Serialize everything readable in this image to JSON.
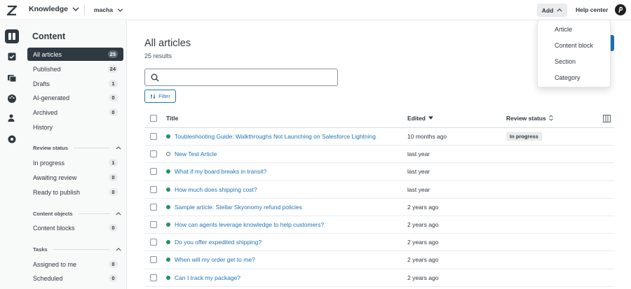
{
  "topbar": {
    "product": "Knowledge",
    "brand": "macha",
    "add_label": "Add",
    "help_label": "Help center"
  },
  "sidebar": {
    "title": "Content",
    "items": [
      {
        "label": "All articles",
        "count": "25"
      },
      {
        "label": "Published",
        "count": "24"
      },
      {
        "label": "Drafts",
        "count": "1"
      },
      {
        "label": "AI-generated",
        "count": "0"
      },
      {
        "label": "Archived",
        "count": "0"
      },
      {
        "label": "History"
      }
    ],
    "review_section": "Review status",
    "review_items": [
      {
        "label": "In progress",
        "count": "1"
      },
      {
        "label": "Awaiting review",
        "count": "0"
      },
      {
        "label": "Ready to publish",
        "count": "0"
      }
    ],
    "objects_section": "Content objects",
    "objects_items": [
      {
        "label": "Content blocks",
        "count": "0"
      }
    ],
    "tasks_section": "Tasks",
    "tasks_items": [
      {
        "label": "Assigned to me",
        "count": "0"
      },
      {
        "label": "Scheduled",
        "count": "0"
      }
    ]
  },
  "main": {
    "title": "All articles",
    "results": "25 results",
    "filter_label": "Filter",
    "columns": {
      "title": "Title",
      "edited": "Edited",
      "review": "Review status"
    },
    "rows": [
      {
        "title": "Toubleshooting Guide: Walkthroughs Not Launching on Salesforce Lightning",
        "edited": "10 months ago",
        "review": "In progress",
        "status": "published"
      },
      {
        "title": "New Test Article",
        "edited": "last year",
        "review": "",
        "status": "draft"
      },
      {
        "title": "What if my board breaks in transit?",
        "edited": "last year",
        "review": "",
        "status": "published"
      },
      {
        "title": "How much does shipping cost?",
        "edited": "last year",
        "review": "",
        "status": "published"
      },
      {
        "title": "Sample article: Stellar Skyonomy refund policies",
        "edited": "2 years ago",
        "review": "",
        "status": "published"
      },
      {
        "title": "How can agents leverage knowledge to help customers?",
        "edited": "2 years ago",
        "review": "",
        "status": "published"
      },
      {
        "title": "Do you offer expedited shipping?",
        "edited": "2 years ago",
        "review": "",
        "status": "published"
      },
      {
        "title": "When will my order get to me?",
        "edited": "2 years ago",
        "review": "",
        "status": "published"
      },
      {
        "title": "Can I track my package?",
        "edited": "2 years ago",
        "review": "",
        "status": "published"
      }
    ]
  },
  "add_menu": {
    "items": [
      "Article",
      "Content block",
      "Section",
      "Category"
    ]
  },
  "colors": {
    "accent": "#1f73b7",
    "published_dot": "#228f67",
    "active_nav": "#2f3941"
  }
}
